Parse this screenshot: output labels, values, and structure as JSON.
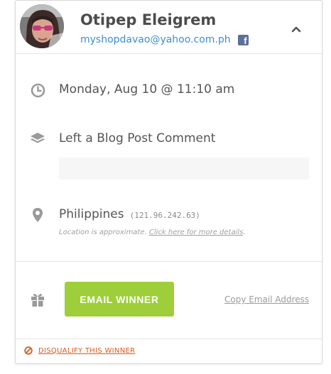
{
  "entrant": {
    "name": "Otipep Eleigrem",
    "email": "myshopdavao@yahoo.com.ph",
    "social_icon": "facebook-icon"
  },
  "entry": {
    "datetime": "Monday, Aug 10 @ 11:10 am",
    "action": "Left a Blog Post Comment",
    "comment": ""
  },
  "location": {
    "country": "Philippines",
    "ip": "(121.96.242.63)",
    "note": "Location is approximate.",
    "details_link": "Click here for more details",
    "note_end": "."
  },
  "actions": {
    "email_winner_label": "EMAIL WINNER",
    "copy_email_label": "Copy Email Address",
    "disqualify_label": "DISQUALIFY THIS WINNER"
  },
  "colors": {
    "accent_green": "#9ecf3a",
    "link_blue": "#3d8fd1",
    "facebook_blue": "#5b6f98",
    "danger_orange": "#d9591b"
  }
}
